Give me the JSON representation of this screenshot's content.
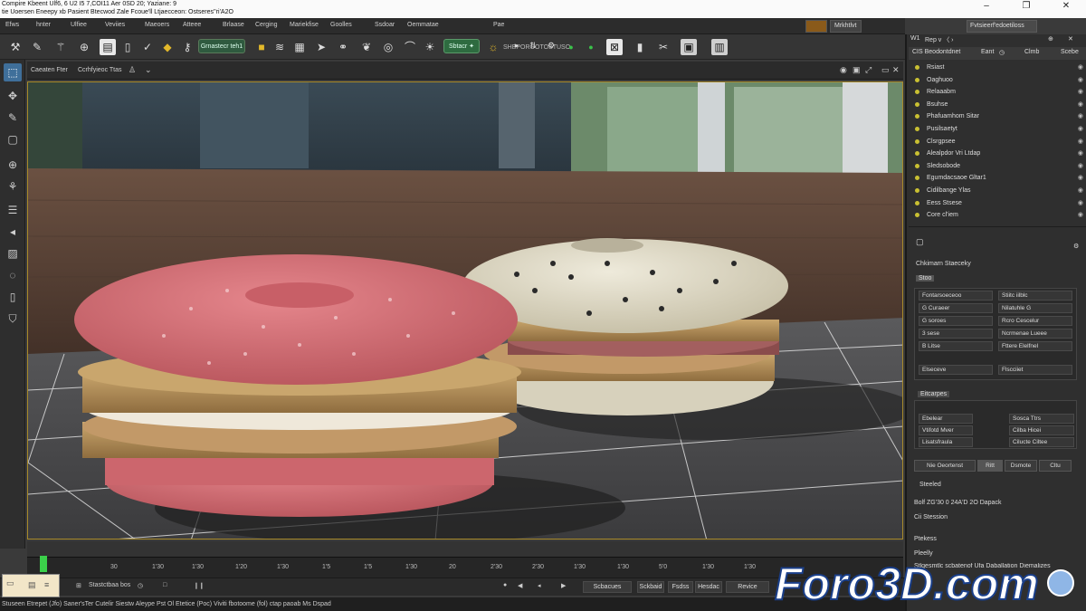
{
  "titlebar": {
    "line1": "Compire Kbeent Ulf6, 6 U2 I5 7,COI11 Aer 0SD 20; Yaziane: 9",
    "line2": "tie Uoersen Eneepy xb Pasient Btecwod Zale Fcoue'll Ltjaecceon: Ostseres''ri'A2O",
    "minimize": "–",
    "maximize": "❐",
    "close": "✕"
  },
  "menu": {
    "items": [
      "Efws",
      "hnter",
      "Ulfiee",
      "Veviies",
      "Maeoers",
      "Atteee",
      "Brlaase",
      "Cerging",
      "Mariekfise",
      "Goolles",
      "Ssdoar",
      "Oemmatae",
      "Pae"
    ],
    "right_box": "Mrkhtlvt",
    "right_search": "Fvtsieerf'edoetiloss"
  },
  "toolbar": {
    "pill1": "Grnastecr teh1",
    "pill2": "Sbtacr  ✦",
    "label1": "SHEPOROOTOSTUSO"
  },
  "viewport": {
    "header_label1": "Caeaten  Fter",
    "header_label2": "Ccrhfyieoc  Ttas"
  },
  "timeline": {
    "ticks": [
      "30",
      "1'30",
      "1'30",
      "1'20",
      "1'30",
      "1'5",
      "1'5",
      "1'30",
      "20",
      "2'30",
      "2'30",
      "1'30",
      "1'30",
      "5'0",
      "1'30",
      "1'30"
    ]
  },
  "playback": {
    "label_left": "Stastctbaa bos",
    "label_mid1": "Scbacues",
    "label_mid2": "Sckbaid",
    "label_mid3": "Fsdss",
    "label_mid4": "Hesdac",
    "btn_revice": "Revice"
  },
  "statusbar": {
    "text": "Stuseen Etrepet (Jfo) Saner'sTer  Cutelir  Siestw   Aleype Pst Ol Etetice (Poc) Viviti fbotoome (fol) ctap paoab Ms Dspad"
  },
  "rightpanel": {
    "top_label1": "W1",
    "top_label2": "Rep v  〈 ›",
    "tab1": "CIS  Beodontdnet",
    "tab2": "Eant",
    "tab3": "Clmb",
    "tab4": "Scebe",
    "scene_items": [
      "Rsiast",
      "Oaghuoo",
      "Relaaabm",
      "Bsuhse",
      "Phafuamhom Sitar",
      "Pusilsaetyt",
      "Clsrgpsee",
      "Alealpdor Vri Ltdap",
      "Sledsobode",
      "Egumdacsaoe Gltar1",
      "Cidilbange Ylas",
      "Eess Stsese",
      "Core  cl'iem"
    ],
    "props_title": "Chkimarn Staeceky",
    "props_badge": "Stoo",
    "grid1_left": [
      "Fontarsoeceoo",
      "G Curaeer",
      "G soroes",
      "3 sese",
      "B Litse"
    ],
    "grid1_right": [
      "Stiitc iilblc",
      "Nilatuhle G",
      "Rcro Cescelur",
      "Ncrmenae Lueee",
      "Fttere Elelfnel"
    ],
    "grid1_foot_left": "Elseceve",
    "grid1_foot_right": "Flscciiet",
    "sec2_title": "Eitcarpes",
    "grid2_left": [
      "Ebelear",
      "Vtifotd Mver",
      "Lisatsfraula"
    ],
    "grid2_right": [
      "Sosca Ttrs",
      "Cilba Hicei",
      "Cilucte Ciltee"
    ],
    "btn_left": "Nie Oeortenst",
    "btn_mid": "Ritt",
    "btn_mid2": "Dsmote",
    "btn_right": "Cltu",
    "label_sleeted": "Steeled",
    "info1": "Bolf ZG'30 0 24A'D 2O Dapack",
    "info2": "Cii Stession",
    "info3": "Ptekess",
    "info4": "Pleelly",
    "info5": "Stlgesmtlc scbatenof Ufa Daballation Diemalizes"
  },
  "watermark": {
    "text": "Foro3D.com"
  },
  "colors": {
    "accent_blue": "#3f6f9a",
    "timeline_green": "#3bd04a",
    "dot_yellow": "#c9c032",
    "pink_macaron": "#d77278",
    "cream_macaron": "#e1dcc6"
  }
}
